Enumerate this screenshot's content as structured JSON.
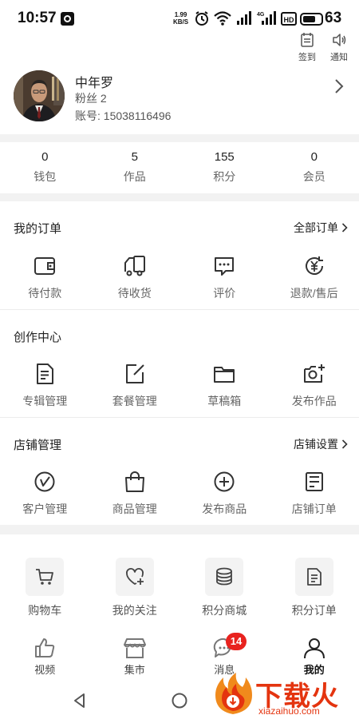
{
  "status_bar": {
    "time": "10:57",
    "speed_value": "1.99",
    "speed_unit": "KB/S",
    "battery": "63"
  },
  "top_actions": [
    {
      "label": "签到",
      "icon": "calendar-icon"
    },
    {
      "label": "通知",
      "icon": "speaker-icon"
    }
  ],
  "profile": {
    "name": "中年罗",
    "fans": "粉丝 2",
    "account": "账号: 15038116496"
  },
  "stats": [
    {
      "value": "0",
      "label": "钱包"
    },
    {
      "value": "5",
      "label": "作品"
    },
    {
      "value": "155",
      "label": "积分"
    },
    {
      "value": "0",
      "label": "会员"
    }
  ],
  "orders": {
    "title": "我的订单",
    "link": "全部订单",
    "items": [
      {
        "label": "待付款",
        "icon": "wallet-icon"
      },
      {
        "label": "待收货",
        "icon": "truck-icon"
      },
      {
        "label": "评价",
        "icon": "comment-icon"
      },
      {
        "label": "退款/售后",
        "icon": "refund-icon"
      }
    ]
  },
  "creation": {
    "title": "创作中心",
    "items": [
      {
        "label": "专辑管理",
        "icon": "document-icon"
      },
      {
        "label": "套餐管理",
        "icon": "edit-icon"
      },
      {
        "label": "草稿箱",
        "icon": "folder-icon"
      },
      {
        "label": "发布作品",
        "icon": "camera-add-icon"
      }
    ]
  },
  "store": {
    "title": "店铺管理",
    "link": "店铺设置",
    "items": [
      {
        "label": "客户管理",
        "icon": "compass-icon"
      },
      {
        "label": "商品管理",
        "icon": "bag-icon"
      },
      {
        "label": "发布商品",
        "icon": "plus-circle-icon"
      },
      {
        "label": "店铺订单",
        "icon": "order-list-icon"
      }
    ]
  },
  "tools": [
    {
      "label": "购物车",
      "icon": "cart-icon"
    },
    {
      "label": "我的关注",
      "icon": "heart-plus-icon"
    },
    {
      "label": "积分商城",
      "icon": "coins-icon"
    },
    {
      "label": "积分订单",
      "icon": "doc-list-icon"
    }
  ],
  "tabbar": [
    {
      "label": "视频",
      "icon": "thumbs-up-icon"
    },
    {
      "label": "集市",
      "icon": "shop-icon"
    },
    {
      "label": "消息",
      "icon": "chat-icon",
      "badge": "14"
    },
    {
      "label": "我的",
      "icon": "user-icon",
      "active": true
    }
  ],
  "watermark": {
    "text": "下载火",
    "sub": "xiazaihuo.com"
  },
  "colors": {
    "badge": "#e8231f",
    "watermark": "#e4340f",
    "divider": "#f2f2f2"
  }
}
